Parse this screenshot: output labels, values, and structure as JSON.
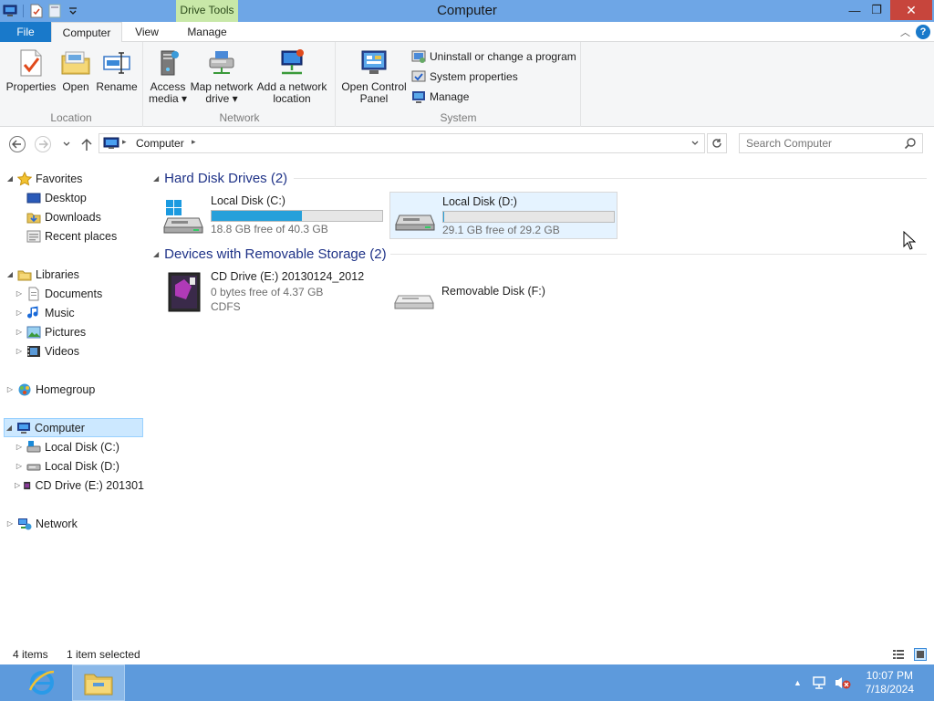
{
  "window": {
    "title": "Computer",
    "context_tab": "Drive Tools",
    "minimize": "—",
    "restore": "❐",
    "close": "✕"
  },
  "ribbon_tabs": [
    {
      "label": "File"
    },
    {
      "label": "Computer"
    },
    {
      "label": "View"
    },
    {
      "label": "Manage"
    }
  ],
  "ribbon": {
    "location": {
      "label": "Location",
      "buttons": [
        {
          "label": "Properties"
        },
        {
          "label": "Open"
        },
        {
          "label": "Rename"
        }
      ]
    },
    "network": {
      "label": "Network",
      "buttons": [
        {
          "line1": "Access",
          "line2": "media ▾"
        },
        {
          "line1": "Map network",
          "line2": "drive ▾"
        },
        {
          "line1": "Add a network",
          "line2": "location"
        }
      ]
    },
    "system": {
      "label": "System",
      "big_button": {
        "line1": "Open Control",
        "line2": "Panel"
      },
      "small_buttons": [
        {
          "label": "Uninstall or change a program"
        },
        {
          "label": "System properties"
        },
        {
          "label": "Manage"
        }
      ]
    }
  },
  "address": {
    "path": "Computer",
    "search_placeholder": "Search Computer"
  },
  "nav_pane": {
    "favorites": "Favorites",
    "desktop": "Desktop",
    "downloads": "Downloads",
    "recent": "Recent places",
    "libraries": "Libraries",
    "documents": "Documents",
    "music": "Music",
    "pictures": "Pictures",
    "videos": "Videos",
    "homegroup": "Homegroup",
    "computer": "Computer",
    "local_c": "Local Disk (C:)",
    "local_d": "Local Disk (D:)",
    "cd_drive": "CD Drive (E:) 201301",
    "network": "Network"
  },
  "content": {
    "hdd_header": "Hard Disk Drives (2)",
    "removable_header": "Devices with Removable Storage (2)",
    "drives": [
      {
        "name": "Local Disk (C:)",
        "free": "18.8 GB free of 40.3 GB",
        "used_fraction": 0.53
      },
      {
        "name": "Local Disk (D:)",
        "free": "29.1 GB free of 29.2 GB",
        "used_fraction": 0.004
      }
    ],
    "removable": [
      {
        "name": "CD Drive (E:) 20130124_2012",
        "line2": "0 bytes free of 4.37 GB",
        "line3": "CDFS"
      },
      {
        "name": "Removable Disk (F:)"
      }
    ]
  },
  "status": {
    "items": "4 items",
    "selected": "1 item selected"
  },
  "taskbar": {
    "time": "10:07 PM",
    "date": "7/18/2024"
  }
}
